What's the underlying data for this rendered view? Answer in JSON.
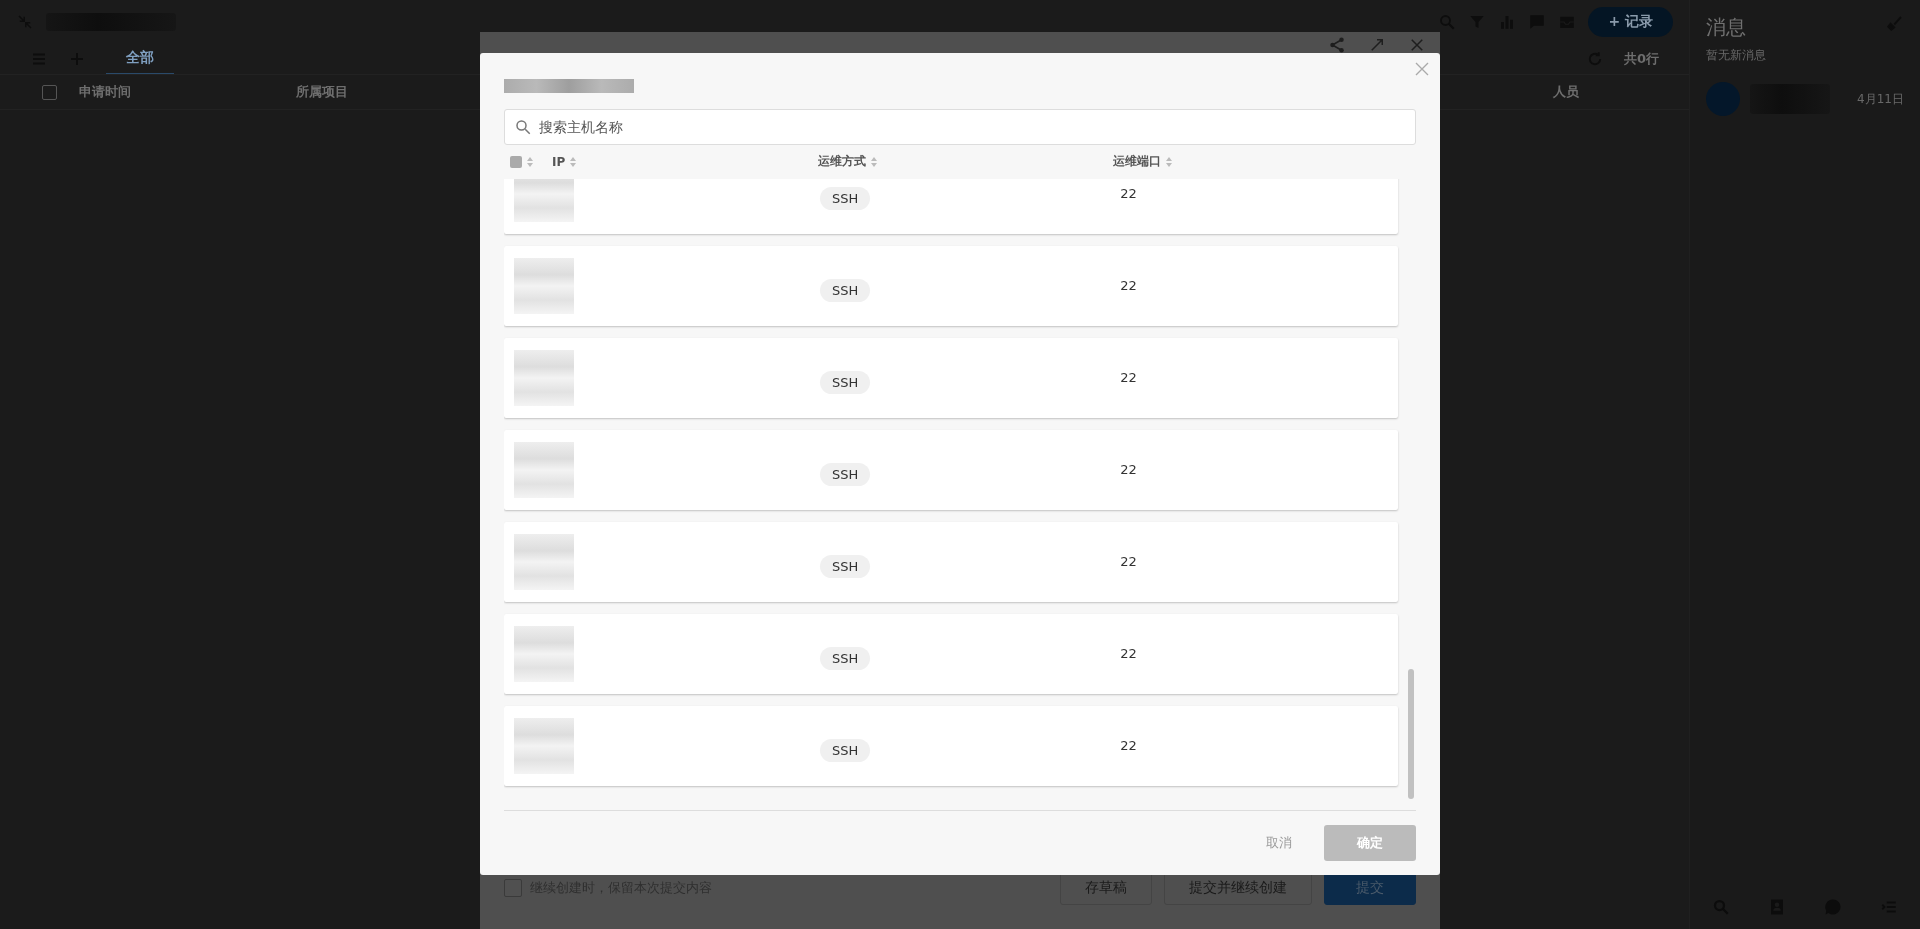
{
  "page": {
    "select_all": {
      "checked": false
    },
    "tabs": [
      {
        "label": "全部",
        "selected": true
      }
    ],
    "columns": [
      "申请时间",
      "所属项目",
      "人员"
    ],
    "add_button": "+ 记录",
    "row_count": "共0行"
  },
  "messages": {
    "title": "消息",
    "empty_note": "暂无新消息",
    "items": [
      {
        "date": "4月11日"
      }
    ]
  },
  "form": {
    "keep_option": {
      "label": "继续创建时，保留本次提交内容",
      "checked": false
    },
    "buttons": [
      {
        "label": "存草稿",
        "kind": "plain"
      },
      {
        "label": "提交并继续创建",
        "kind": "plain"
      },
      {
        "label": "提交",
        "kind": "primary"
      }
    ]
  },
  "dialog": {
    "search": {
      "placeholder": "搜索主机名称"
    },
    "columns": [
      "IP",
      "运维方式",
      "运维端口"
    ],
    "rows": [
      {
        "method": "SSH",
        "port": "22"
      },
      {
        "method": "SSH",
        "port": "22"
      },
      {
        "method": "SSH",
        "port": "22"
      },
      {
        "method": "SSH",
        "port": "22"
      },
      {
        "method": "SSH",
        "port": "22"
      },
      {
        "method": "SSH",
        "port": "22"
      },
      {
        "method": "SSH",
        "port": "22"
      }
    ],
    "cancel": "取消",
    "confirm": {
      "label": "确定",
      "disabled": true
    }
  }
}
